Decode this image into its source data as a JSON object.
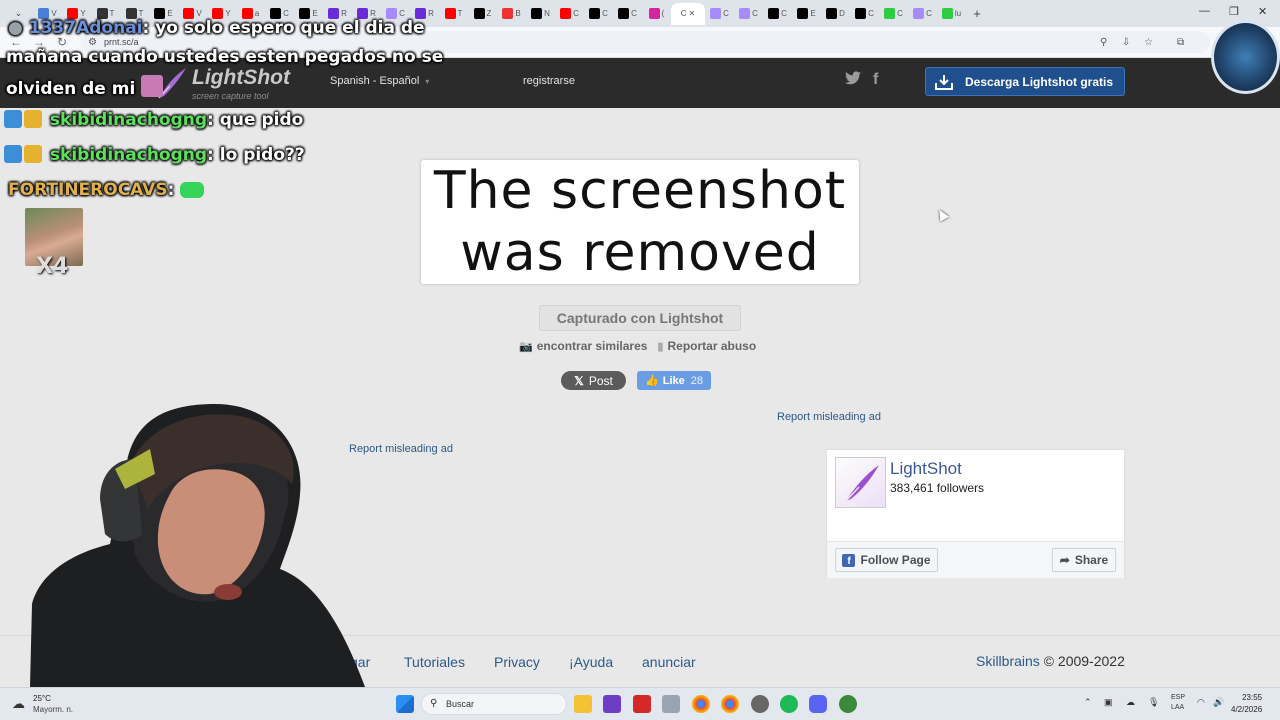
{
  "browser": {
    "address_url": "prnt.sc/a",
    "tab_labels": [
      "V",
      "Y",
      "T",
      "T",
      "E",
      "V",
      "Y",
      "a",
      "C",
      "E",
      "R",
      "R",
      "C",
      "R",
      "T",
      "Z",
      "B",
      "N",
      "C",
      "C",
      "C",
      "(",
      "C",
      "C",
      "C",
      "E",
      "D",
      "C",
      "C",
      "C",
      "lu"
    ],
    "active_tab_label": "C"
  },
  "site": {
    "logo_title": "LightShot",
    "logo_subtitle": "screen capture tool",
    "language": "Spanish - Español",
    "register": "registrarse",
    "download_button": "Descarga Lightshot gratis",
    "colors": {
      "header_bg": "#2b2b2b",
      "download_bg": "#1f4f8c",
      "link": "#2a5a8c"
    }
  },
  "main": {
    "removed_line1": "The screenshot",
    "removed_line2": "was removed",
    "captured_label": "Capturado con Lightshot",
    "find_similar": "encontrar similares",
    "report_abuse": "Reportar abuso",
    "post_label": "Post",
    "like_label": "Like",
    "like_count": "28",
    "report_ad_1": "Report misleading ad",
    "report_ad_2": "Report misleading ad"
  },
  "fb_widget": {
    "page_name": "LightShot",
    "followers": "383,461 followers",
    "follow_button": "Follow Page",
    "share_button": "Share"
  },
  "footer": {
    "links": [
      "gar",
      "Tutoriales",
      "Privacy",
      "¡Ayuda",
      "anunciar"
    ],
    "company": "Skillbrains",
    "copyright": " © 2009-2022"
  },
  "stream_overlay": {
    "chat": [
      {
        "user": "1337Adonai",
        "message": ": yo solo espero que el dia de"
      },
      {
        "user": "",
        "message": "mañana cuando ustedes esten pegados no se"
      },
      {
        "user": "",
        "message": "olviden de mi"
      },
      {
        "user": "skibidinachogng",
        "message": ": que pido"
      },
      {
        "user": "skibidinachogng",
        "message": ": lo pido??"
      },
      {
        "user": "FORTINEROCAVS",
        "message": ":"
      }
    ],
    "emote_multiplier": "X4"
  },
  "taskbar": {
    "weather_temp": "25°C",
    "weather_desc": "Mayorm. n.",
    "search_placeholder": "Buscar",
    "lang_top": "ESP",
    "lang_bottom": "LAA",
    "time": "23:55",
    "date": "4/2/2026"
  }
}
